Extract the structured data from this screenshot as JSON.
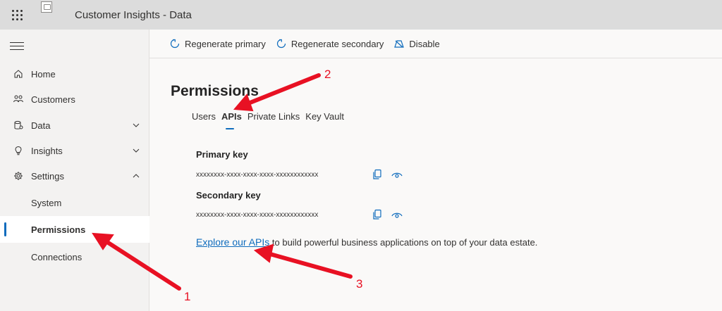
{
  "app": {
    "title": "Customer Insights - Data"
  },
  "sidebar": {
    "items": [
      {
        "label": "Home",
        "icon": "home-icon"
      },
      {
        "label": "Customers",
        "icon": "people-icon"
      },
      {
        "label": "Data",
        "icon": "database-icon"
      },
      {
        "label": "Insights",
        "icon": "lightbulb-icon"
      },
      {
        "label": "Settings",
        "icon": "gear-icon"
      }
    ],
    "sub_items": [
      {
        "label": "System"
      },
      {
        "label": "Permissions",
        "active": true
      },
      {
        "label": "Connections"
      }
    ]
  },
  "commands": [
    {
      "label": "Regenerate primary",
      "icon": "refresh-icon"
    },
    {
      "label": "Regenerate secondary",
      "icon": "refresh-icon"
    },
    {
      "label": "Disable",
      "icon": "disable-icon"
    }
  ],
  "page": {
    "title": "Permissions",
    "tabs": [
      {
        "label": "Users"
      },
      {
        "label": "APIs",
        "active": true
      },
      {
        "label": "Private Links"
      },
      {
        "label": "Key Vault"
      }
    ],
    "primary_key": {
      "label": "Primary key",
      "value": "xxxxxxxx-xxxx-xxxx-xxxx-xxxxxxxxxxxx"
    },
    "secondary_key": {
      "label": "Secondary key",
      "value": "xxxxxxxx-xxxx-xxxx-xxxx-xxxxxxxxxxxx"
    },
    "explore": {
      "link": "Explore our APIs",
      "rest": " to build powerful business applications on top of your data estate."
    }
  },
  "annotations": {
    "n1": "1",
    "n2": "2",
    "n3": "3",
    "color": "#e81123"
  },
  "colors": {
    "accent": "#0f6cbd",
    "annotation": "#e81123"
  }
}
